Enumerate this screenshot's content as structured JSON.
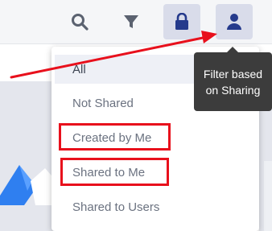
{
  "toolbar": {
    "icons": [
      "search-icon",
      "filter-icon",
      "lock-icon",
      "user-icon"
    ]
  },
  "dropdown": {
    "items": [
      {
        "label": "All",
        "selected": true
      },
      {
        "label": "Not Shared",
        "selected": false
      },
      {
        "label": "Created by Me",
        "selected": false
      },
      {
        "label": "Shared to Me",
        "selected": false
      },
      {
        "label": "Shared to Users",
        "selected": false
      }
    ]
  },
  "tooltip": {
    "text": "Filter based on Sharing"
  },
  "colors": {
    "icon": "#253a8c",
    "highlight": "#e8101c",
    "tooltip_bg": "#3c3c3c",
    "button_bg": "#d9dcea"
  }
}
